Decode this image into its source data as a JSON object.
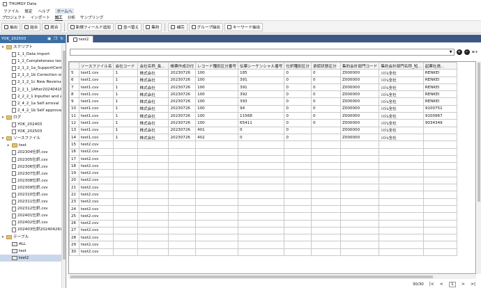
{
  "window": {
    "title": "THUMGY Data"
  },
  "menus": [
    "ファイル",
    "設定",
    "ヘルプ",
    "ホームへ"
  ],
  "ribbon_tabs": [
    "プロジェクト",
    "インポート",
    "加工",
    "分析",
    "サンプリング"
  ],
  "toolbar": [
    {
      "label": "抽出",
      "icon": "extract-icon"
    },
    {
      "label": "結合",
      "icon": "join-icon"
    },
    {
      "label": "統合",
      "icon": "merge-icon"
    },
    {
      "label": "新規フィールド追加",
      "icon": "add-field-icon"
    },
    {
      "label": "並べ替え",
      "icon": "sort-icon"
    },
    {
      "label": "集約",
      "icon": "aggregate-icon"
    },
    {
      "label": "補完",
      "icon": "complement-icon"
    },
    {
      "label": "グループ抽出",
      "icon": "group-extract-icon"
    },
    {
      "label": "キーワード抽出",
      "icon": "keyword-extract-icon"
    }
  ],
  "sidebar": {
    "project": "YOK_202503",
    "tree": [
      {
        "label": "スクリプト",
        "type": "folder",
        "level": 0,
        "expanded": true
      },
      {
        "label": "1_1_Data import",
        "type": "file",
        "level": 1
      },
      {
        "label": "1_2_Completeness test",
        "type": "file",
        "level": 1
      },
      {
        "label": "2_1_2_1a_SupportCenter(P...",
        "type": "file",
        "level": 1
      },
      {
        "label": "2_1_2_1b Correction of pu...",
        "type": "file",
        "level": 1
      },
      {
        "label": "2_1_2_1c New Revenue Rec...",
        "type": "file",
        "level": 1
      },
      {
        "label": "2_2_1_1After20240418",
        "type": "file",
        "level": 1
      },
      {
        "label": "2_2_2_1 Inputter and appr...",
        "type": "file",
        "level": 1
      },
      {
        "label": "2_4_2_1a Self arroval",
        "type": "file",
        "level": 1
      },
      {
        "label": "2_4_2_1b Self approval an...",
        "type": "file",
        "level": 1
      },
      {
        "label": "ログ",
        "type": "folder",
        "level": 0,
        "expanded": true
      },
      {
        "label": "YOK_202403",
        "type": "file",
        "level": 1
      },
      {
        "label": "YOK_202503",
        "type": "file",
        "level": 1
      },
      {
        "label": "ソースファイル",
        "type": "folder",
        "level": 0,
        "expanded": true
      },
      {
        "label": "test",
        "type": "folder",
        "level": 1,
        "expanded": false
      },
      {
        "label": "202304仕訳.csv",
        "type": "file",
        "level": 1
      },
      {
        "label": "202305仕訳.csv",
        "type": "file",
        "level": 1
      },
      {
        "label": "202306仕訳.csv",
        "type": "file",
        "level": 1
      },
      {
        "label": "202307仕訳.csv",
        "type": "file",
        "level": 1
      },
      {
        "label": "202308仕訳.csv",
        "type": "file",
        "level": 1
      },
      {
        "label": "202309仕訳.csv",
        "type": "file",
        "level": 1
      },
      {
        "label": "202310仕訳.csv",
        "type": "file",
        "level": 1
      },
      {
        "label": "202311仕訳.csv",
        "type": "file",
        "level": 1
      },
      {
        "label": "202312仕訳.csv",
        "type": "file",
        "level": 1
      },
      {
        "label": "202401仕訳.csv",
        "type": "file",
        "level": 1
      },
      {
        "label": "202402仕訳.csv",
        "type": "file",
        "level": 1
      },
      {
        "label": "202403仕訳20240426以下...",
        "type": "file",
        "level": 1
      },
      {
        "label": "テーブル",
        "type": "folder",
        "level": 0,
        "expanded": true
      },
      {
        "label": "ALL",
        "type": "table",
        "level": 1
      },
      {
        "label": "test",
        "type": "table",
        "level": 1
      },
      {
        "label": "test2",
        "type": "table",
        "level": 1,
        "selected": true
      }
    ]
  },
  "tab": {
    "label": "test2"
  },
  "grid": {
    "columns": [
      "",
      "ソースファイル名",
      "会社コード",
      "会社名称_長...",
      "帳票作成日付",
      "レコード種別区分番号",
      "伝票シーケンシャル番号",
      "仕訳種別区分",
      "承認状態区分",
      "集約会計部門コード",
      "集約会計部門名称_短...",
      "起票社員..."
    ],
    "rows": [
      [
        "5",
        "test1.csv",
        "1",
        "株式会社",
        "20230726",
        "100",
        "185",
        "0",
        "0",
        "Z000000",
        "ｼｽﾃﾑ全社",
        "RENKEI"
      ],
      [
        "6",
        "test1.csv",
        "1",
        "株式会社",
        "20230726",
        "100",
        "391",
        "0",
        "0",
        "Z000000",
        "ｼｽﾃﾑ全社",
        "RENKEI"
      ],
      [
        "7",
        "test1.csv",
        "1",
        "株式会社",
        "20230726",
        "100",
        "391",
        "0",
        "0",
        "Z000000",
        "ｼｽﾃﾑ全社",
        "RENKEI"
      ],
      [
        "8",
        "test1.csv",
        "1",
        "株式会社",
        "20230726",
        "100",
        "392",
        "0",
        "0",
        "Z000000",
        "ｼｽﾃﾑ全社",
        "RENKEI"
      ],
      [
        "9",
        "test1.csv",
        "1",
        "株式会社",
        "20230726",
        "100",
        "393",
        "0",
        "0",
        "Z000000",
        "ｼｽﾃﾑ全社",
        "RENKEI"
      ],
      [
        "10",
        "test1.csv",
        "1",
        "株式会社",
        "20230726",
        "100",
        "94",
        "0",
        "0",
        "Z000000",
        "ｼｽﾃﾑ全社",
        "9100751"
      ],
      [
        "11",
        "test1.csv",
        "1",
        "株式会社",
        "20230726",
        "100",
        "11568",
        "0",
        "0",
        "Z000000",
        "ｼｽﾃﾑ全社",
        "9100967"
      ],
      [
        "12",
        "test1.csv",
        "1",
        "株式会社",
        "20230726",
        "100",
        "65411",
        "0",
        "0",
        "Z000000",
        "ｼｽﾃﾑ全社",
        "9034349"
      ],
      [
        "13",
        "test1.csv",
        "1",
        "株式会社",
        "20230726",
        "401",
        "0",
        "0",
        "",
        "Z000000",
        "ｼｽﾃﾑ全社",
        ""
      ],
      [
        "14",
        "test1.csv",
        "1",
        "株式会社",
        "20230726",
        "402",
        "0",
        "0",
        "",
        "Z000000",
        "ｼｽﾃﾑ全社",
        ""
      ],
      [
        "15",
        "test2.csv",
        "",
        "",
        "",
        "",
        "",
        "",
        "",
        "",
        "",
        ""
      ],
      [
        "16",
        "test2.csv",
        "",
        "",
        "",
        "",
        "",
        "",
        "",
        "",
        "",
        ""
      ],
      [
        "17",
        "test2.csv",
        "",
        "",
        "",
        "",
        "",
        "",
        "",
        "",
        "",
        ""
      ],
      [
        "18",
        "test2.csv",
        "",
        "",
        "",
        "",
        "",
        "",
        "",
        "",
        "",
        ""
      ],
      [
        "19",
        "test2.csv",
        "",
        "",
        "",
        "",
        "",
        "",
        "",
        "",
        "",
        ""
      ],
      [
        "20",
        "test2.csv",
        "",
        "",
        "",
        "",
        "",
        "",
        "",
        "",
        "",
        ""
      ],
      [
        "21",
        "test2.csv",
        "",
        "",
        "",
        "",
        "",
        "",
        "",
        "",
        "",
        ""
      ],
      [
        "22",
        "test2.csv",
        "",
        "",
        "",
        "",
        "",
        "",
        "",
        "",
        "",
        ""
      ],
      [
        "23",
        "test2.csv",
        "",
        "",
        "",
        "",
        "",
        "",
        "",
        "",
        "",
        ""
      ],
      [
        "24",
        "test2.csv",
        "",
        "",
        "",
        "",
        "",
        "",
        "",
        "",
        "",
        ""
      ],
      [
        "25",
        "test2.csv",
        "",
        "",
        "",
        "",
        "",
        "",
        "",
        "",
        "",
        ""
      ],
      [
        "26",
        "test2.csv",
        "",
        "",
        "",
        "",
        "",
        "",
        "",
        "",
        "",
        ""
      ],
      [
        "27",
        "test2.csv",
        "",
        "",
        "",
        "",
        "",
        "",
        "",
        "",
        "",
        ""
      ],
      [
        "28",
        "test2.csv",
        "",
        "",
        "",
        "",
        "",
        "",
        "",
        "",
        "",
        ""
      ],
      [
        "29",
        "test2.csv",
        "",
        "",
        "",
        "",
        "",
        "",
        "",
        "",
        "",
        ""
      ],
      [
        "30",
        "test2.csv",
        "",
        "",
        "",
        "",
        "",
        "",
        "",
        "",
        "",
        ""
      ]
    ]
  },
  "status": {
    "count": "30/30",
    "page": "1"
  }
}
